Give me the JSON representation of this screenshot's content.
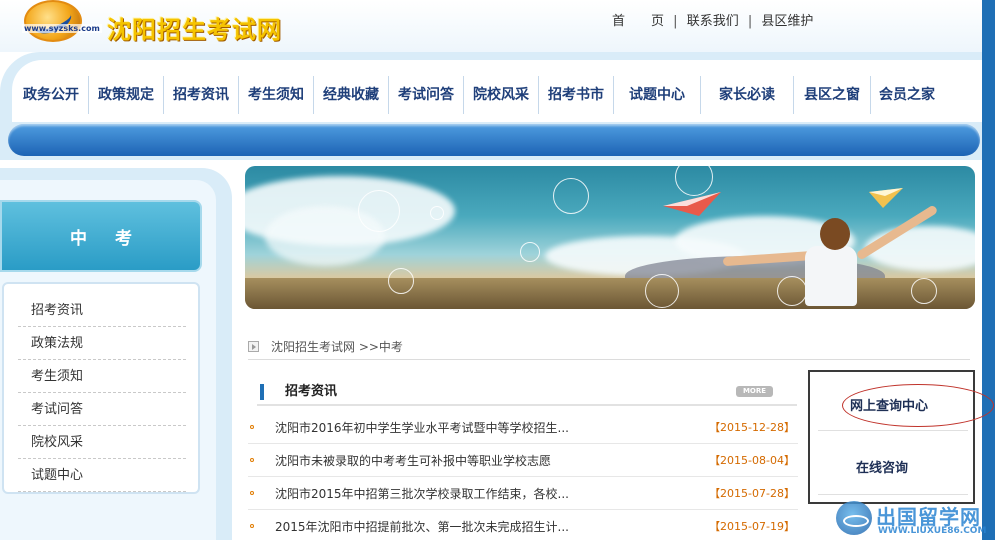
{
  "header": {
    "logo_url": "www.syzsks.com",
    "site_title": "沈阳招生考试网",
    "top_links": [
      "首　　页",
      "联系我们",
      "县区维护"
    ],
    "separator": "|"
  },
  "nav": {
    "items": [
      "政务公开",
      "政策规定",
      "招考资讯",
      "考生须知",
      "经典收藏",
      "考试问答",
      "院校风采",
      "招考书市",
      "试题中心",
      "家长必读",
      "县区之窗",
      "会员之家"
    ]
  },
  "sidebar": {
    "section_title": "中考",
    "items": [
      "招考资讯",
      "政策法规",
      "考生须知",
      "考试问答",
      "院校风采",
      "试题中心"
    ]
  },
  "breadcrumb": {
    "text": "沈阳招生考试网 >>中考"
  },
  "news": {
    "title": "招考资讯",
    "more_label": "MORE",
    "items": [
      {
        "title": "沈阳市2016年初中学生学业水平考试暨中等学校招生...",
        "date": "【2015-12-28】"
      },
      {
        "title": "沈阳市未被录取的中考考生可补报中等职业学校志愿",
        "date": "【2015-08-04】"
      },
      {
        "title": "沈阳市2015年中招第三批次学校录取工作结束，各校...",
        "date": "【2015-07-28】"
      },
      {
        "title": "2015年沈阳市中招提前批次、第一批次未完成招生计...",
        "date": "【2015-07-19】"
      }
    ]
  },
  "query_box": {
    "online_query": "网上查询中心",
    "online_consult": "在线咨询"
  },
  "watermark": {
    "text": "出国留学网",
    "url": "WWW.LIUXUE86.COM"
  },
  "colors": {
    "nav_text": "#1f3f7a",
    "accent_blue": "#1f6fb5",
    "date_orange": "#d46a00",
    "title_yellow": "#f5c300",
    "annotation_red": "#c0332b"
  }
}
